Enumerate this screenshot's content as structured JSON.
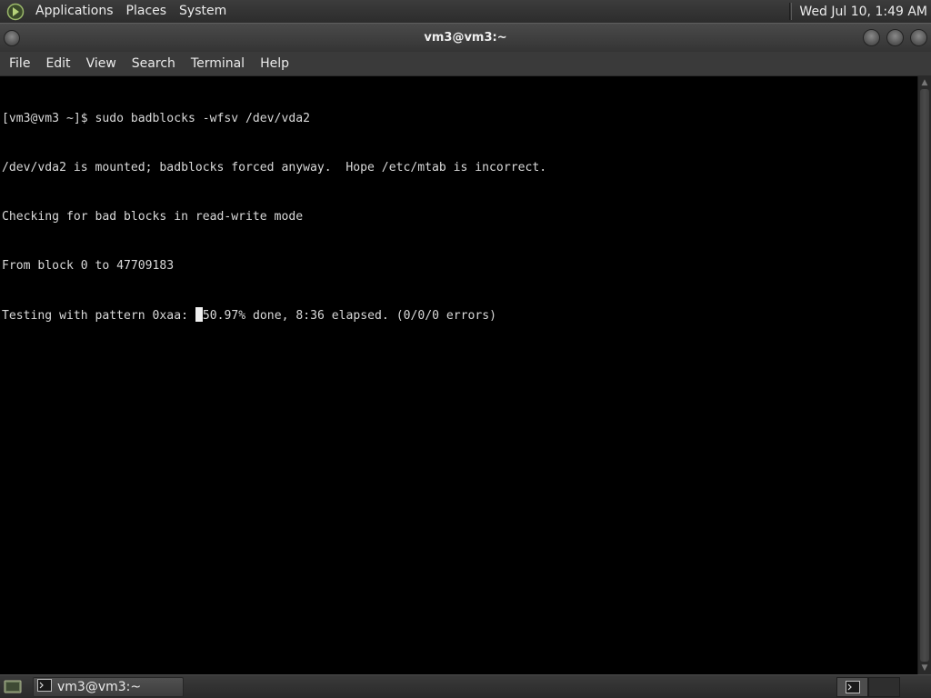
{
  "top_panel": {
    "menus": [
      {
        "label": "Applications",
        "icon": "gnome-foot-icon"
      },
      {
        "label": "Places"
      },
      {
        "label": "System"
      }
    ],
    "clock": "Wed Jul 10,  1:49 AM"
  },
  "window": {
    "title": "vm3@vm3:~",
    "buttons": [
      "minimize",
      "maximize",
      "close"
    ]
  },
  "menubar": {
    "items": [
      "File",
      "Edit",
      "View",
      "Search",
      "Terminal",
      "Help"
    ]
  },
  "terminal": {
    "lines": [
      "[vm3@vm3 ~]$ sudo badblocks -wfsv /dev/vda2",
      "/dev/vda2 is mounted; badblocks forced anyway.  Hope /etc/mtab is incorrect.",
      "Checking for bad blocks in read-write mode",
      "From block 0 to 47709183"
    ],
    "progress_prefix": "Testing with pattern 0xaa: ",
    "progress_suffix": "50.97% done, 8:36 elapsed. (0/0/0 errors)",
    "progress_percent": 50.97
  },
  "taskbar": {
    "tasks": [
      {
        "label": "vm3@vm3:~",
        "icon": "terminal-icon"
      }
    ],
    "workspaces": 2,
    "active_workspace": 1
  },
  "colors": {
    "terminal_bg": "#000000",
    "terminal_fg": "#d9d9d9",
    "panel_bg": "#333333"
  }
}
